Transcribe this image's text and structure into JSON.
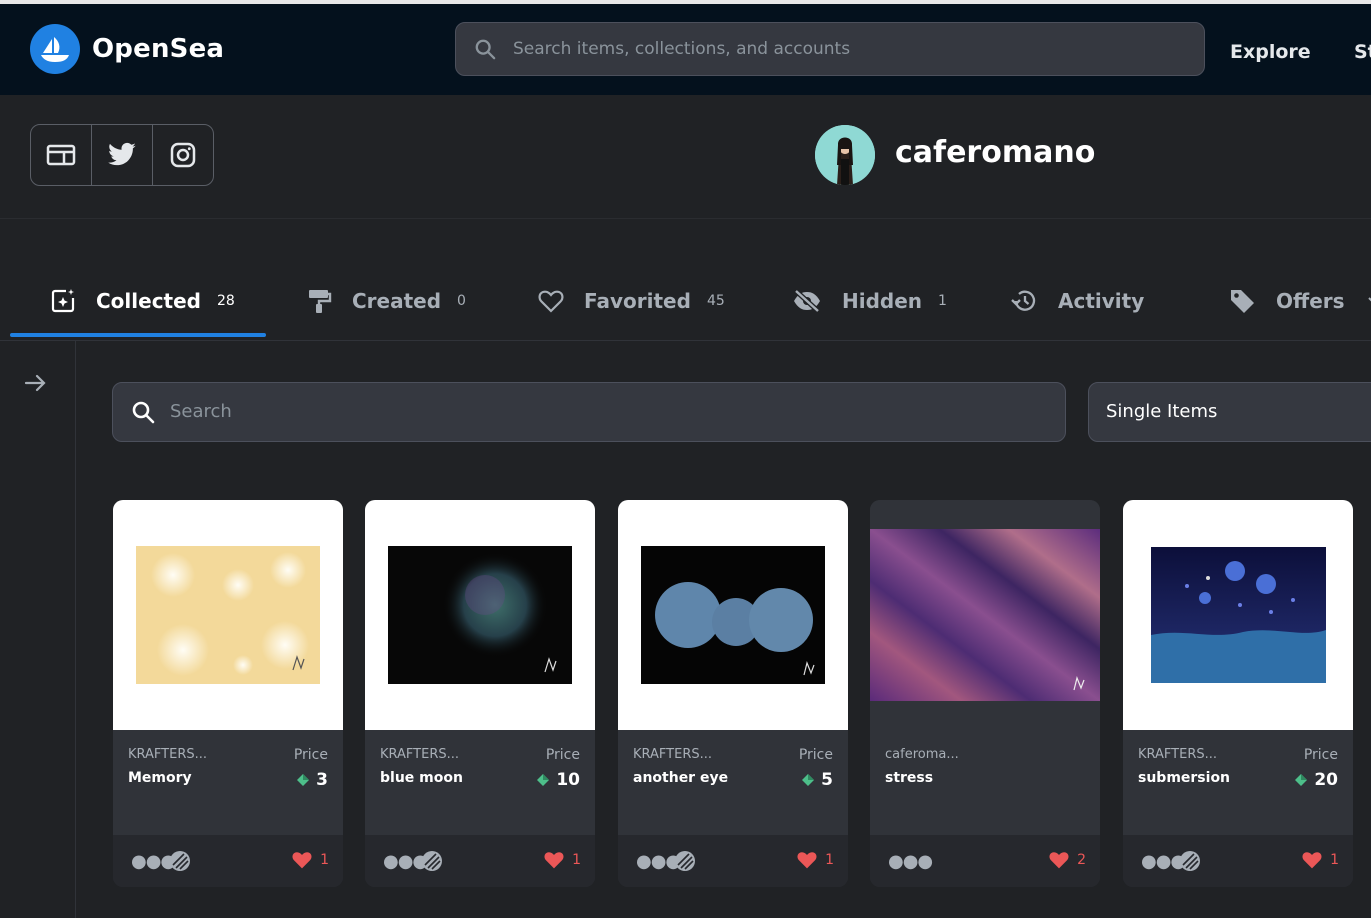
{
  "header": {
    "brand": "OpenSea",
    "search_placeholder": "Search items, collections, and accounts",
    "nav": [
      "Explore",
      "St"
    ]
  },
  "profile": {
    "username": "caferomano",
    "social_links": [
      "website-icon",
      "twitter-icon",
      "instagram-icon"
    ]
  },
  "tabs": [
    {
      "label": "Collected",
      "count": "28",
      "icon": "collected-icon",
      "active": true
    },
    {
      "label": "Created",
      "count": "0",
      "icon": "paintbrush-icon"
    },
    {
      "label": "Favorited",
      "count": "45",
      "icon": "heart-icon"
    },
    {
      "label": "Hidden",
      "count": "1",
      "icon": "eye-off-icon"
    },
    {
      "label": "Activity",
      "count": "",
      "icon": "history-icon"
    },
    {
      "label": "Offers",
      "count": "",
      "icon": "tag-icon"
    }
  ],
  "filters": {
    "search_placeholder": "Search",
    "view_select": "Single Items"
  },
  "items": [
    {
      "collection": "KRAFTERS...",
      "name": "Memory",
      "price_label": "Price",
      "price": "3",
      "likes": "1"
    },
    {
      "collection": "KRAFTERS...",
      "name": "blue moon",
      "price_label": "Price",
      "price": "10",
      "likes": "1"
    },
    {
      "collection": "KRAFTERS...",
      "name": "another eye",
      "price_label": "Price",
      "price": "5",
      "likes": "1"
    },
    {
      "collection": "caferoma...",
      "name": "stress",
      "price_label": "",
      "price": "",
      "likes": "2"
    },
    {
      "collection": "KRAFTERS...",
      "name": "submersion",
      "price_label": "Price",
      "price": "20",
      "likes": "1"
    }
  ],
  "colors": {
    "accent": "#2081e2",
    "header_bg": "#04111d",
    "page_bg": "#202225",
    "card_bg": "#303339",
    "like": "#eb5757"
  }
}
